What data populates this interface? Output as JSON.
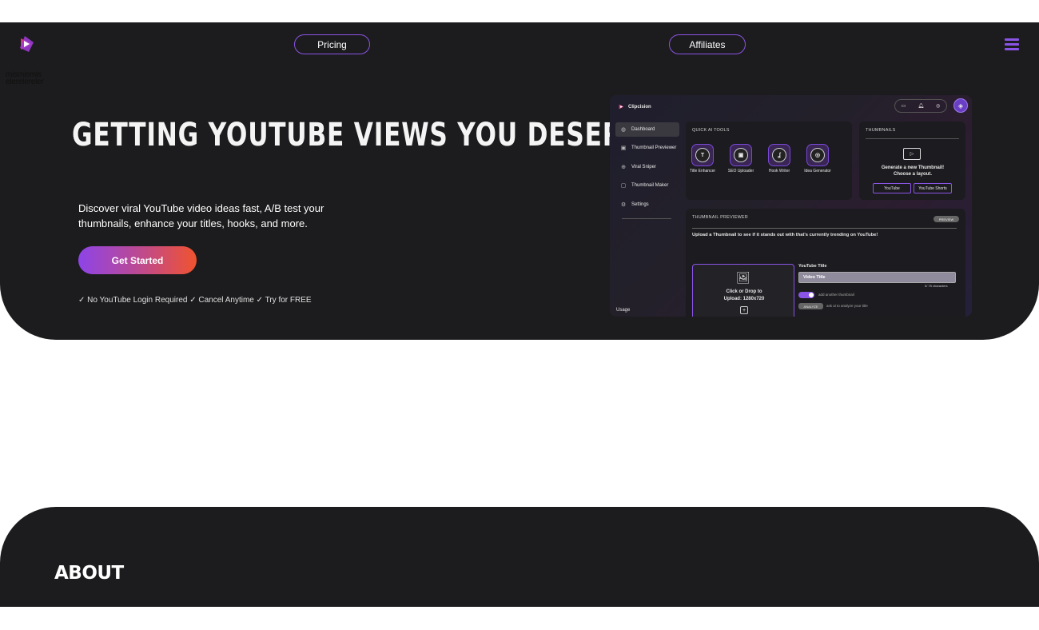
{
  "nav": {
    "logo_icon": "clipcision-logo-icon",
    "garbled_text": [
      "mismismis",
      "elerelereler"
    ],
    "pricing_label": "Pricing",
    "affiliates_label": "Affiliates",
    "menu_icon": "hamburger-menu-icon"
  },
  "hero": {
    "headline": "GETTING YOUTUBE VIEWS YOU DESERVE",
    "subtitle": "Discover viral YouTube video ideas fast, A/B test your thumbnails, enhance your titles, hooks, and more.",
    "cta_label": "Get Started",
    "perks": "✓ No YouTube Login Required  ✓ Cancel Anytime ✓ Try for FREE"
  },
  "preview": {
    "brand": "Clipcision",
    "sidebar": [
      {
        "label": "Dashboard",
        "icon": "globe-icon"
      },
      {
        "label": "Thumbnail Previewer",
        "icon": "image-icon"
      },
      {
        "label": "Viral Sniper",
        "icon": "crosshair-icon"
      },
      {
        "label": "Thumbnail Maker",
        "icon": "monitor-icon"
      },
      {
        "label": "Settings",
        "icon": "gear-icon"
      }
    ],
    "usage_label": "Usage",
    "quick_tools_title": "QUICK AI TOOLS",
    "tools": [
      {
        "label": "Title Enhancer",
        "glyph": "T"
      },
      {
        "label": "SEO Uploader",
        "glyph": "▣"
      },
      {
        "label": "Hook Writer",
        "glyph": "ʆ"
      },
      {
        "label": "Idea Generator",
        "glyph": "◎"
      }
    ],
    "thumbnails_title": "THUMBNAILS",
    "generate_text": "Generate a new Thumbnail! Choose a layout.",
    "youtube_btn": "YouTube",
    "shorts_btn": "YouTube Shorts",
    "previewer_title": "THUMBNAIL PREVIEWER",
    "preview_badge": "PREVIEW",
    "previewer_desc": "Upload a Thumbnail to see if it stands out with that's currently trending on YouTube!",
    "upload_text": "Click or Drop to Upload: 1280x720",
    "yt_title_label": "YouTube Title",
    "yt_title_value": "Video Title",
    "char_count": "0/ 75 characters",
    "add_thumbnail_text": "add another thumbnail",
    "analyze_label": "ANALYZE",
    "ask_ai_text": "ask ai to analyze your title"
  },
  "about": {
    "title": "ABOUT"
  },
  "colors": {
    "accent": "#8a55e6",
    "dark_bg": "#1c1b1d",
    "cta_start": "#8e44e8",
    "cta_end": "#f0532e"
  }
}
